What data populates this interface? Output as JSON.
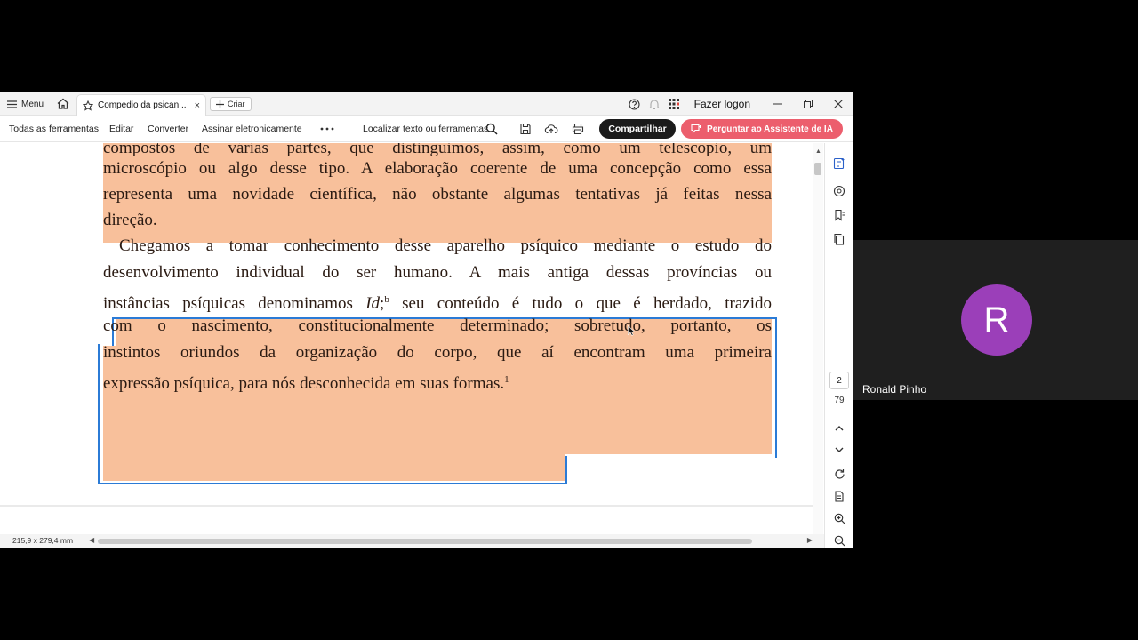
{
  "titlebar": {
    "menu_label": "Menu",
    "tab_title": "Compedio da psican...",
    "tab_close": "×",
    "create_label": "Criar",
    "signin_label": "Fazer logon"
  },
  "toolbar": {
    "all_tools": "Todas as ferramentas",
    "edit": "Editar",
    "convert": "Converter",
    "sign": "Assinar eletronicamente",
    "search_placeholder": "Localizar texto ou ferramentas",
    "share": "Compartilhar",
    "ai_assistant": "Perguntar ao Assistente de IA"
  },
  "document": {
    "lines": [
      "compostos de várias partes, que distinguimos, assim, como um telescópio, um",
      "microscópio ou algo desse tipo. A elaboração coerente de uma concepção como essa",
      "representa uma novidade científica, não obstante algumas tentativas já feitas nessa",
      "direção.",
      "Chegamos a tomar conhecimento desse aparelho psíquico mediante o estudo do",
      "desenvolvimento individual do ser humano. A mais antiga dessas províncias ou",
      "com o nascimento, constitucionalmente determinado; sobretudo, portanto, os",
      "instintos oriundos da organização do corpo, que aí encontram uma primeira"
    ],
    "line7_pre": "instâncias psíquicas denominamos ",
    "line7_italic": "Id",
    "line7_sep": ";",
    "line7_sup": "b",
    "line7_post": " seu conteúdo é tudo o que é herdado, trazido",
    "line10_text": "expressão psíquica, para nós desconhecida em suas formas.",
    "line10_sup": "1"
  },
  "navigation": {
    "current_page": "2",
    "total_pages": "79"
  },
  "statusbar": {
    "page_size": "215,9 x 279,4 mm"
  },
  "call": {
    "avatar_initial": "R",
    "participant_name": "Ronald Pinho",
    "avatar_color": "#9b3fb9"
  },
  "colors": {
    "highlight": "#f8c09b",
    "selection": "#2b7bd6",
    "ai_button": "#ec5e6d",
    "share_button": "#1b1b1b"
  }
}
